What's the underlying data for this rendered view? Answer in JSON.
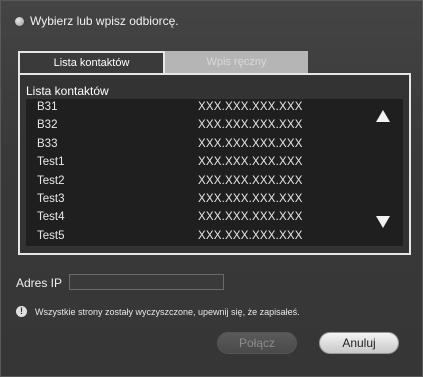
{
  "header": {
    "prompt": "Wybierz lub wpisz odbiorcę."
  },
  "tabs": [
    {
      "label": "Lista kontaktów"
    },
    {
      "label": "Wpis ręczny"
    }
  ],
  "contacts": {
    "title": "Lista kontaktów",
    "rows": [
      {
        "name": "B31",
        "address": "XXX.XXX.XXX.XXX"
      },
      {
        "name": "B32",
        "address": "XXX.XXX.XXX.XXX"
      },
      {
        "name": "B33",
        "address": "XXX.XXX.XXX.XXX"
      },
      {
        "name": "Test1",
        "address": "XXX.XXX.XXX.XXX"
      },
      {
        "name": "Test2",
        "address": "XXX.XXX.XXX.XXX"
      },
      {
        "name": "Test3",
        "address": "XXX.XXX.XXX.XXX"
      },
      {
        "name": "Test4",
        "address": "XXX.XXX.XXX.XXX"
      },
      {
        "name": "Test5",
        "address": "XXX.XXX.XXX.XXX"
      }
    ]
  },
  "ip": {
    "label": "Adres IP",
    "value": ""
  },
  "notice": {
    "text": "Wszystkie strony zostały wyczyszczone, upewnij się, że zapisałeś."
  },
  "buttons": {
    "connect": "Połącz",
    "cancel": "Anuluj"
  }
}
